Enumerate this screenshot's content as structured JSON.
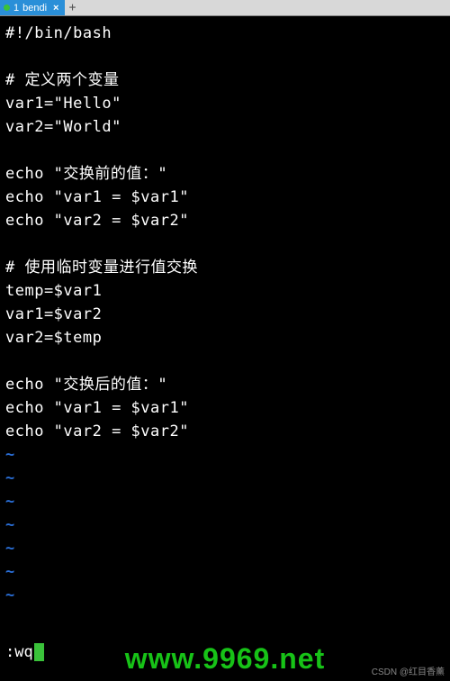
{
  "tab": {
    "index": "1",
    "name": "bendi",
    "close": "×",
    "plus": "+"
  },
  "lines": [
    "#!/bin/bash",
    "",
    "# 定义两个变量",
    "var1=\"Hello\"",
    "var2=\"World\"",
    "",
    "echo \"交换前的值：\"",
    "echo \"var1 = $var1\"",
    "echo \"var2 = $var2\"",
    "",
    "# 使用临时变量进行值交换",
    "temp=$var1",
    "var1=$var2",
    "var2=$temp",
    "",
    "echo \"交换后的值：\"",
    "echo \"var1 = $var1\"",
    "echo \"var2 = $var2\""
  ],
  "tilde": "~",
  "tilde_count": 7,
  "command": ":wq",
  "watermark": "www.9969.net",
  "credit": "CSDN @红目香薰"
}
